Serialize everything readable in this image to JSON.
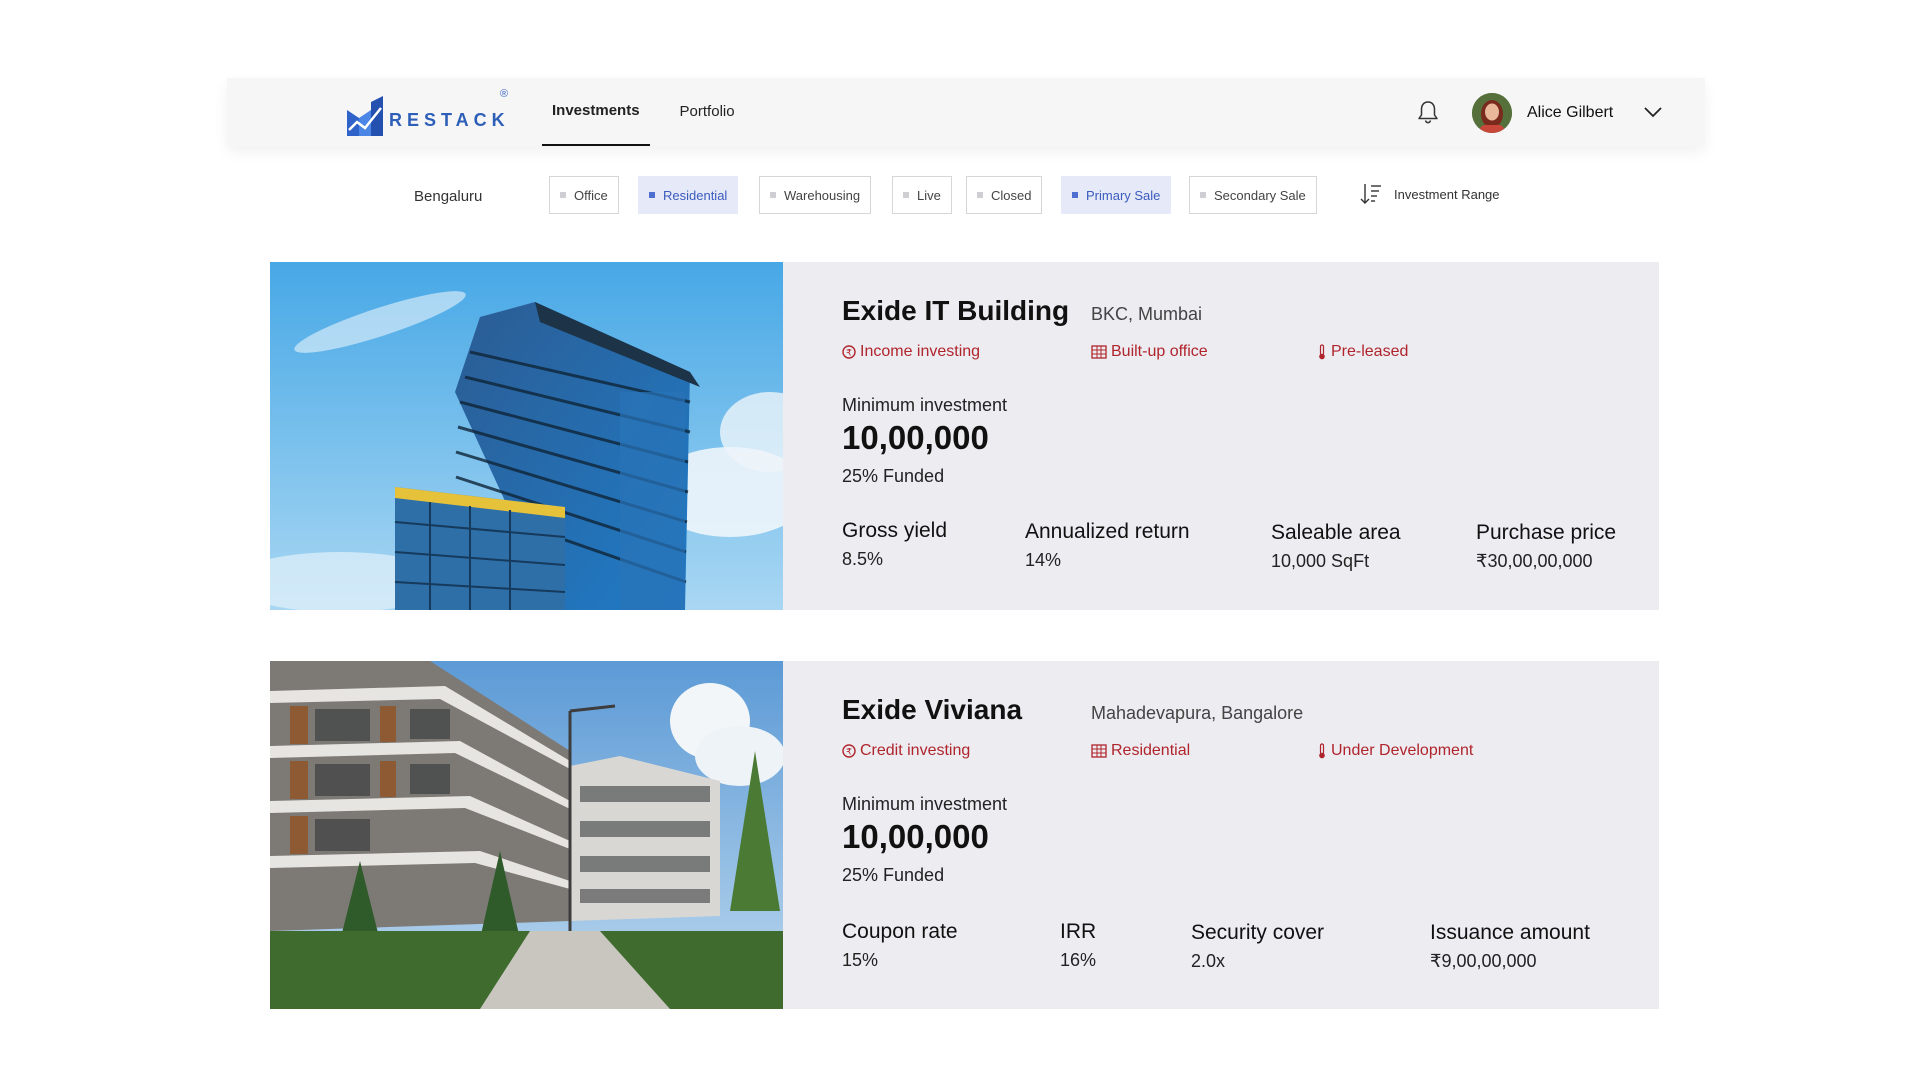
{
  "header": {
    "logo_text": "RESTACK",
    "logo_reg": "®",
    "nav": [
      {
        "label": "Investments",
        "active": true
      },
      {
        "label": "Portfolio",
        "active": false
      }
    ],
    "user_name": "Alice Gilbert",
    "icons": {
      "bell": "bell-icon",
      "chevron": "chevron-down-icon"
    }
  },
  "filters": {
    "city": "Bengaluru",
    "chips": [
      {
        "label": "Office",
        "selected": false
      },
      {
        "label": "Residential",
        "selected": true
      },
      {
        "label": "Warehousing",
        "selected": false
      },
      {
        "label": "Live",
        "selected": false
      },
      {
        "label": "Closed",
        "selected": false
      },
      {
        "label": "Primary Sale",
        "selected": true
      },
      {
        "label": "Secondary Sale",
        "selected": false
      }
    ],
    "range_label": "Investment Range"
  },
  "colors": {
    "accent": "#3b5bbf",
    "tag_red": "#b0242c",
    "card_bg": "#ececf1"
  },
  "properties": [
    {
      "name": "Exide IT Building",
      "location": "BKC, Mumbai",
      "tags": [
        "Income investing",
        "Built-up office",
        "Pre-leased"
      ],
      "min_investment_label": "Minimum investment",
      "min_investment_value": "10,00,000",
      "funded": "25% Funded",
      "metrics": [
        {
          "label": "Gross yield",
          "value": "8.5%"
        },
        {
          "label": "Annualized return",
          "value": "14%"
        },
        {
          "label": "Saleable area",
          "value": "10,000 SqFt"
        },
        {
          "label": "Purchase price",
          "value": "₹30,00,00,000"
        }
      ]
    },
    {
      "name": "Exide Viviana",
      "location": "Mahadevapura, Bangalore",
      "tags": [
        "Credit investing",
        "Residential",
        "Under Development"
      ],
      "min_investment_label": "Minimum investment",
      "min_investment_value": "10,00,000",
      "funded": "25% Funded",
      "metrics": [
        {
          "label": "Coupon rate",
          "value": "15%"
        },
        {
          "label": "IRR",
          "value": "16%"
        },
        {
          "label": "Security cover",
          "value": "2.0x"
        },
        {
          "label": "Issuance amount",
          "value": "₹9,00,00,000"
        }
      ]
    }
  ]
}
